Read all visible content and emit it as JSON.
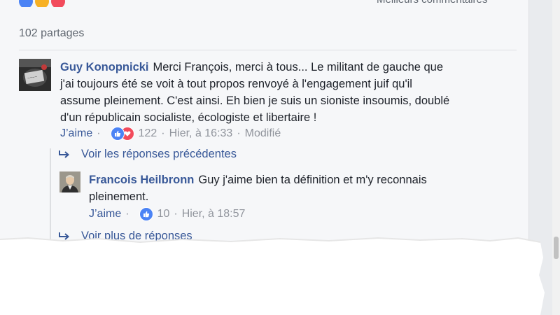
{
  "post": {
    "shares": "102 partages",
    "sort_label": "Meilleurs commentaires"
  },
  "comments": [
    {
      "author": "Guy Konopnicki",
      "text": "Merci François, merci à tous... Le militant de gauche que j'ai toujours été se voit à tout propos renvoyé à l'engagement juif qu'il assume pleinement. C'est ainsi. Eh bien je suis un sioniste insoumis, doublé d'un républicain socialiste, écologiste et libertaire !",
      "like_label": "J’aime",
      "reaction_count": "122",
      "timestamp": "Hier, à 16:33",
      "edited": "Modifié",
      "reactions": [
        "like-icon",
        "love-icon"
      ]
    }
  ],
  "replies": {
    "previous_label": "Voir les réponses précédentes",
    "items": [
      {
        "author": "Francois Heilbronn",
        "text": "Guy j'aime bien ta définition et m'y reconnais pleinement.",
        "like_label": "J’aime",
        "reaction_count": "10",
        "timestamp": "Hier, à 18:57",
        "reactions": [
          "like-icon"
        ]
      }
    ],
    "more_label": "Voir plus de réponses"
  },
  "colors": {
    "link": "#385898",
    "meta": "#90949c",
    "like": "#4b83f5",
    "love": "#f24b5c"
  }
}
